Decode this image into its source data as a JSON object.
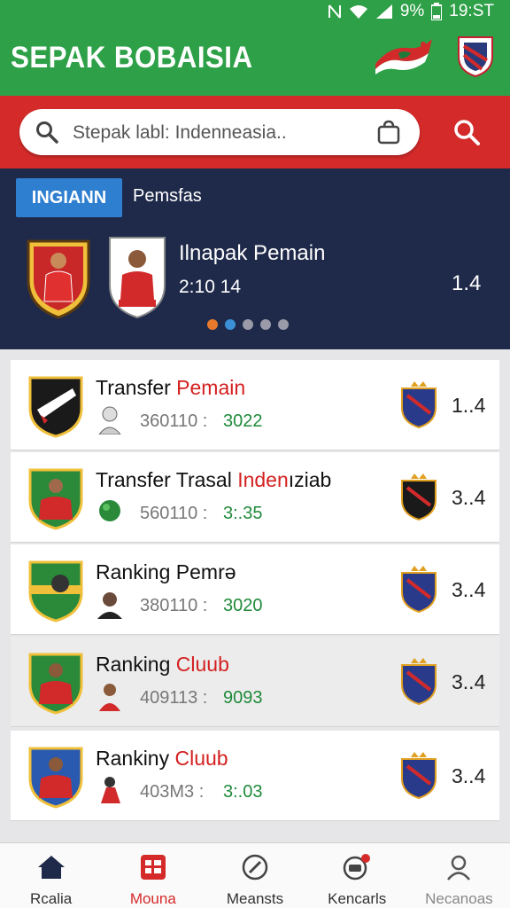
{
  "status_bar": {
    "battery": "9%",
    "time": "19:ST"
  },
  "header": {
    "title": "SEPAK BOBAISIA"
  },
  "search": {
    "placeholder": "Stepak labl: Indenneasia.."
  },
  "featured": {
    "tabs": [
      {
        "label": "INGIANN",
        "active": true
      },
      {
        "label": "Pemsfas",
        "active": false
      }
    ],
    "title": "Ilnapak Pemain",
    "time": "2:10 14",
    "score": "1.4",
    "carousel_dots": [
      "#e87a2e",
      "#3a8fd6",
      "#9a9aa8",
      "#9a9aa8",
      "#9a9aa8"
    ]
  },
  "list": [
    {
      "title_main": "Transfer ",
      "title_highlight": "Pemain",
      "title_tail": "",
      "meta": "360110 :",
      "value": "3022",
      "score": "1..4"
    },
    {
      "title_main": "Transfer Trasal ",
      "title_highlight": "Inden",
      "title_tail": "ıziab",
      "meta": "560110 :",
      "value": "3:.35",
      "score": "3..4"
    },
    {
      "title_main": "Ranking Pemrə",
      "title_highlight": "",
      "title_tail": "",
      "meta": "380110 :",
      "value": "3020",
      "score": "3..4"
    },
    {
      "title_main": "Ranking ",
      "title_highlight": "Cluub",
      "title_tail": "",
      "meta": "409113 :",
      "value": "9093",
      "score": "3..4"
    },
    {
      "title_main": "Rankiny ",
      "title_highlight": "Cluub",
      "title_tail": "",
      "meta": "403M3 :",
      "value": "3:.03",
      "score": "3..4"
    }
  ],
  "bottom_nav": [
    {
      "label": "Rcalia",
      "icon": "home-icon",
      "state": "normal"
    },
    {
      "label": "Mouna",
      "icon": "grid-icon",
      "state": "active"
    },
    {
      "label": "Meansts",
      "icon": "compass-icon",
      "state": "normal"
    },
    {
      "label": "Kencarls",
      "icon": "notifications-icon",
      "state": "normal"
    },
    {
      "label": "Necanoas",
      "icon": "profile-icon",
      "state": "faded"
    }
  ],
  "colors": {
    "header_green": "#2ea048",
    "band_red": "#d42a2a",
    "featured_navy": "#1f2a4a",
    "tab_blue": "#2f7fd0",
    "value_green": "#1f8a3a"
  }
}
